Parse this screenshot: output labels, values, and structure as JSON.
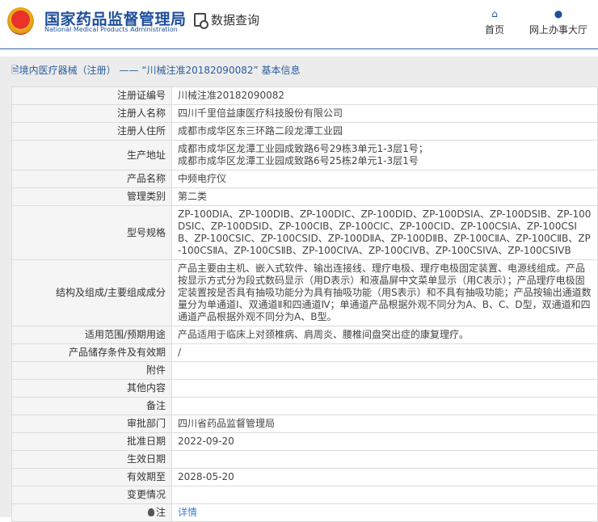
{
  "header": {
    "title_cn": "国家药品监督管理局",
    "title_en": "National Medical Products Administration",
    "data_query": "数据查询",
    "nav": [
      {
        "label": "首页",
        "icon": "home-icon"
      },
      {
        "label": "网上办事大厅",
        "icon": "user-icon"
      }
    ]
  },
  "breadcrumb": "境内医疗器械（注册） —— “川械注准20182090082” 基本信息",
  "rows": [
    {
      "label": "注册证编号",
      "value": "川械注准20182090082"
    },
    {
      "label": "注册人名称",
      "value": "四川千里倍益康医疗科技股份有限公司"
    },
    {
      "label": "注册人住所",
      "value": "成都市成华区东三环路二段龙潭工业园"
    },
    {
      "label": "生产地址",
      "value": "成都市成华区龙潭工业园成致路6号29栋3单元1-3层1号；\n成都市成华区龙潭工业园成致路6号25栋2单元1-3层1号"
    },
    {
      "label": "产品名称",
      "value": "中频电疗仪"
    },
    {
      "label": "管理类别",
      "value": "第二类"
    },
    {
      "label": "型号规格",
      "value": "ZP-100DⅠA、ZP-100DⅠB、ZP-100DⅠC、ZP-100DⅠD、ZP-100DSⅠA、ZP-100DSⅠB、ZP-100DSⅠC、ZP-100DSⅠD、ZP-100CⅠB、ZP-100CⅠC、ZP-100CⅠD、ZP-100CSⅠA、ZP-100CSⅠB、ZP-100CSⅠC、ZP-100CSⅠD、ZP-100DⅡA、ZP-100DⅡB、ZP-100CⅡA、ZP-100CⅡB、ZP-100CSⅡA、ZP-100CSⅡB、ZP-100CIVA、ZP-100CIVB、ZP-100CSIVA、ZP-100CSIVB"
    },
    {
      "label": "结构及组成/主要组成成分",
      "value": "产品主要由主机、嵌入式软件、输出连接线、理疗电极、理疗电极固定装置、电源线组成。产品按显示方式分为段式数码显示（用D表示）和液晶屏中文菜单显示（用C表示）；产品理疗电极固定装置按是否具有抽吸功能分为具有抽吸功能（用S表示）和不具有抽吸功能；产品按输出通道数量分为单通道Ⅰ、双通道Ⅱ和四通道Ⅳ；单通道产品根据外观不同分为A、B、C、D型，双通道和四通道产品根据外观不同分为A、B型。"
    },
    {
      "label": "适用范围/预期用途",
      "value": "产品适用于临床上对颈椎病、肩周炎、腰椎间盘突出症的康复理疗。"
    },
    {
      "label": "产品储存条件及有效期",
      "value": "/"
    },
    {
      "label": "附件",
      "value": ""
    },
    {
      "label": "其他内容",
      "value": ""
    },
    {
      "label": "备注",
      "value": ""
    },
    {
      "label": "审批部门",
      "value": "四川省药品监督管理局"
    },
    {
      "label": "批准日期",
      "value": "2022-09-20"
    },
    {
      "label": "生效日期",
      "value": ""
    },
    {
      "label": "有效期至",
      "value": "2028-05-20"
    },
    {
      "label": "变更情况",
      "value": ""
    }
  ],
  "note": {
    "label": "注",
    "link": "详情"
  }
}
